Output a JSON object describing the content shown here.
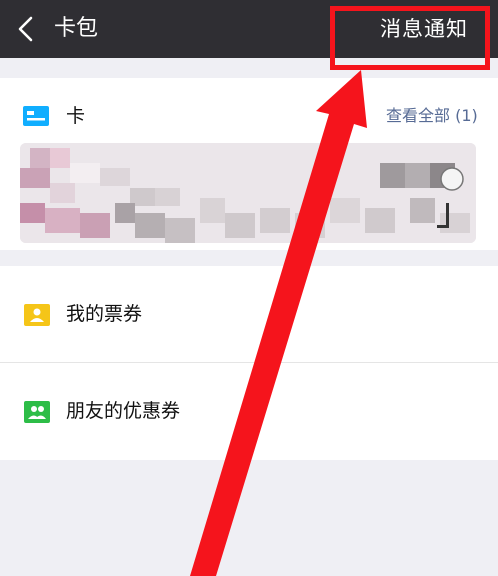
{
  "navbar": {
    "title": "卡包",
    "action_label": "消息通知"
  },
  "cards": {
    "label": "卡",
    "view_all": "查看全部 (1)"
  },
  "list": {
    "items": [
      {
        "label": "我的票券",
        "icon": "ticket-icon",
        "color": "#f5c518"
      },
      {
        "label": "朋友的优惠券",
        "icon": "friends-coupon-icon",
        "color": "#2dbd47"
      }
    ]
  },
  "colors": {
    "navbar_bg": "#2f2e33",
    "accent_link": "#576b95",
    "card_icon": "#10aeff",
    "annotation_red": "#f5141c"
  }
}
